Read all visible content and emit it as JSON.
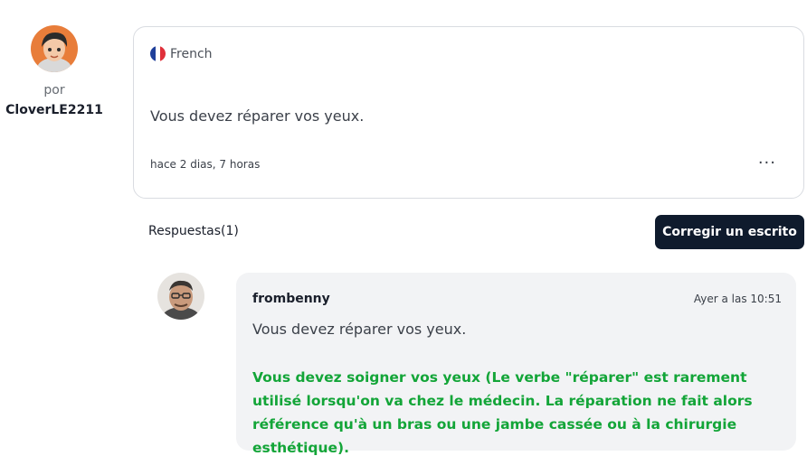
{
  "author": {
    "by_label": "por",
    "username": "CloverLE2211"
  },
  "post": {
    "language": "French",
    "text": "Vous devez réparer vos yeux.",
    "time": "hace 2 dias, 7 horas",
    "more_label": "···"
  },
  "answers": {
    "label": "Respuestas(1)",
    "correct_button_label": "Corregir un escrito"
  },
  "reply": {
    "username": "frombenny",
    "time": "Ayer a las 10:51",
    "original": "Vous devez réparer vos yeux.",
    "correction": "Vous devez soigner vos yeux (Le verbe \"réparer\" est rarement utilisé lorsqu'on va chez le médecin. La réparation ne fait alors référence qu'à un bras ou une jambe cassée ou à la chirurgie esthétique)."
  },
  "colors": {
    "correction_green": "#13a538",
    "button_dark": "#0f1b2d",
    "reply_bg": "#f2f3f5"
  },
  "icons": {
    "flag": "france-flag-icon",
    "more": "more-options-icon"
  }
}
